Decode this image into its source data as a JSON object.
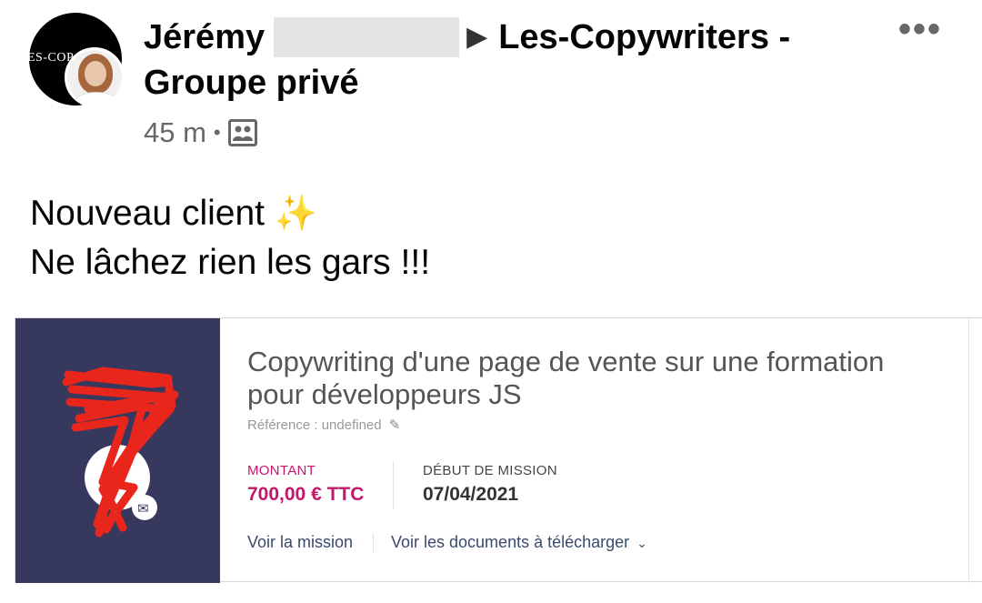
{
  "post": {
    "group_avatar_text": "ES-COP",
    "author": "Jérémy",
    "arrow": "▶",
    "group_name_line1": "Les-Copywriters -",
    "group_name_line2": "Groupe privé",
    "time": "45 m",
    "separator": "•",
    "audience_icon": "group-audience-icon",
    "more": "•••",
    "text_line1": "Nouveau client",
    "sparkle": "✨",
    "text_line2": "Ne lâchez rien les gars !!!"
  },
  "card": {
    "title": "Copywriting d'une page de vente sur une formation pour développeurs JS",
    "reference": "Référence : undefined",
    "pencil": "✎",
    "amount_label": "MONTANT",
    "amount_value": "700,00 € TTC",
    "start_label": "DÉBUT DE MISSION",
    "start_value": "07/04/2021",
    "link_mission": "Voir la mission",
    "link_documents": "Voir les documents à télécharger",
    "chevron": "⌄",
    "mail_icon": "✉"
  },
  "colors": {
    "card_left_bg": "#37385d",
    "accent_pink": "#c2186b",
    "scribble_red": "#e8261c",
    "meta_gray": "#65676b"
  }
}
